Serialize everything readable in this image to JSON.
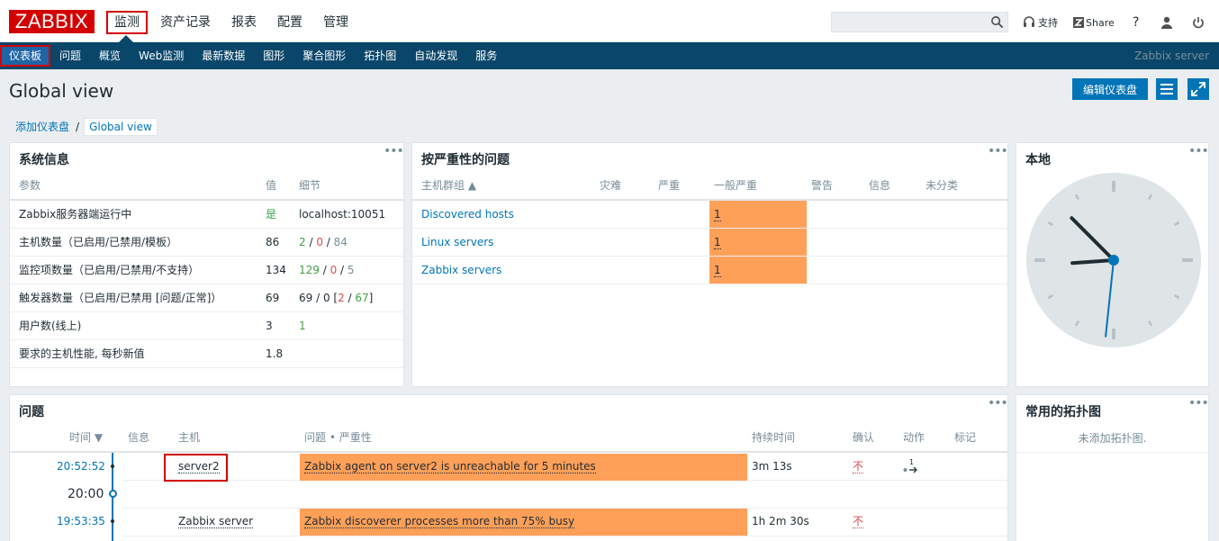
{
  "top": {
    "logo": "ZABBIX",
    "menu": [
      "监测",
      "资产记录",
      "报表",
      "配置",
      "管理"
    ],
    "search_placeholder": "",
    "support_label": "支持",
    "share_label": "Share",
    "help_label": "?"
  },
  "submenu": {
    "items": [
      "仪表板",
      "问题",
      "概览",
      "Web监测",
      "最新数据",
      "图形",
      "聚合图形",
      "拓扑图",
      "自动发现",
      "服务"
    ],
    "server_name": "Zabbix server"
  },
  "page": {
    "title": "Global view",
    "edit_button": "编辑仪表盘",
    "breadcrumb": [
      "添加仪表盘",
      "Global view"
    ]
  },
  "sysinfo": {
    "title": "系统信息",
    "headers": [
      "参数",
      "值",
      "细节"
    ],
    "rows": [
      {
        "param": "Zabbix服务器端运行中",
        "value": "",
        "value_green": "是",
        "detail": "localhost:10051"
      },
      {
        "param": "主机数量（已启用/已禁用/模板）",
        "value": "86",
        "d1": "2",
        "d2": "0",
        "d3": "84"
      },
      {
        "param": "监控项数量（已启用/已禁用/不支持）",
        "value": "134",
        "d1": "129",
        "d2": "0",
        "d3": "5"
      },
      {
        "param": "触发器数量（已启用/已禁用 [问题/正常]）",
        "value": "69",
        "dpre": "69 / 0 [",
        "d1": "2",
        "d2": "67",
        "dpost": "]"
      },
      {
        "param": "用户数(线上)",
        "value": "3",
        "d1": "1"
      },
      {
        "param": "要求的主机性能, 每秒新值",
        "value": "1.8"
      }
    ]
  },
  "severity": {
    "title": "按严重性的问题",
    "headers": [
      "主机群组 ▲",
      "灾难",
      "严重",
      "一般严重",
      "警告",
      "信息",
      "未分类"
    ],
    "rows": [
      {
        "group": "Discovered hosts",
        "average": "1"
      },
      {
        "group": "Linux servers",
        "average": "1"
      },
      {
        "group": "Zabbix servers",
        "average": "1"
      }
    ],
    "colors": {
      "average": "#ffa059"
    }
  },
  "clock": {
    "title": "本地",
    "time": "20:52:31"
  },
  "problems": {
    "title": "问题",
    "headers": [
      "时间 ▼",
      "信息",
      "主机",
      "问题 • 严重性",
      "持续时间",
      "确认",
      "动作",
      "标记"
    ],
    "rows": [
      {
        "time": "20:52:52",
        "host": "server2",
        "problem": "Zabbix agent on server2 is unreachable for 5 minutes",
        "duration": "3m 13s",
        "ack": "不",
        "action_count": "1"
      },
      {
        "divider": "20:00"
      },
      {
        "time": "19:53:35",
        "host": "Zabbix server",
        "problem": "Zabbix discoverer processes more than 75% busy",
        "duration": "1h 2m 30s",
        "ack": "不"
      }
    ]
  },
  "maps": {
    "title": "常用的拓扑图",
    "empty": "未添加拓扑图."
  }
}
